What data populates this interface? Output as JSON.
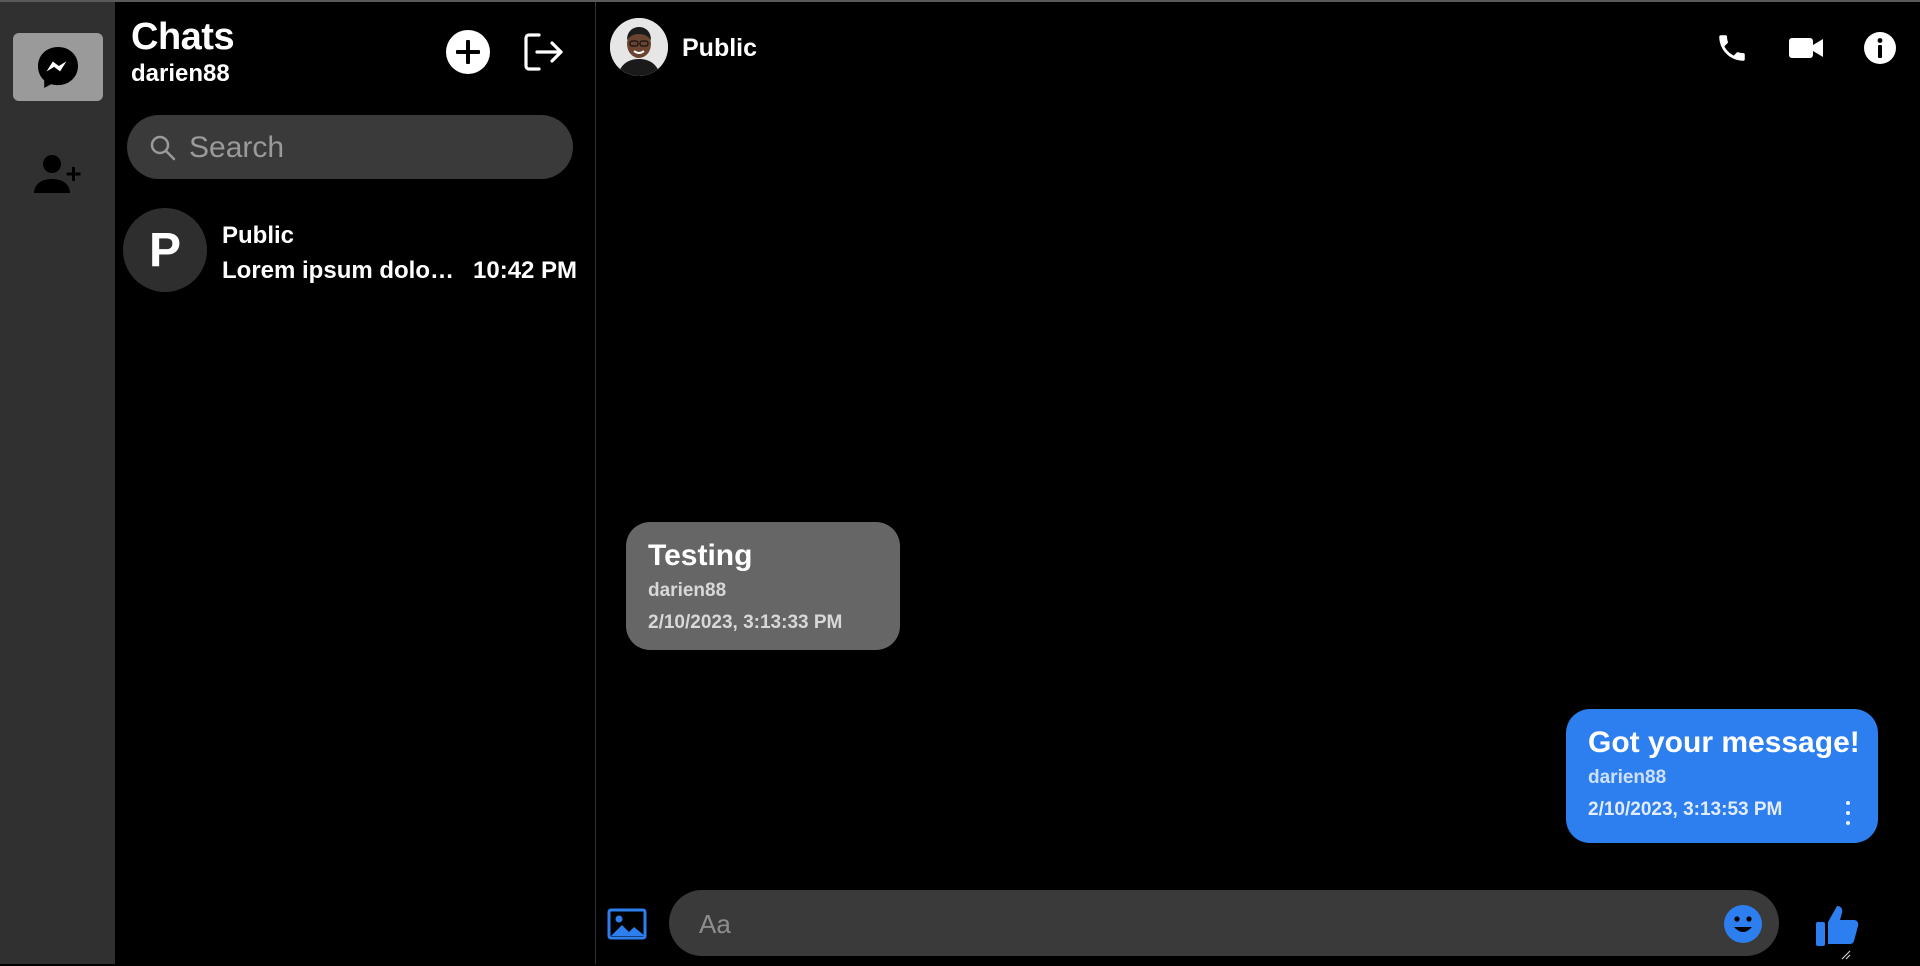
{
  "colors": {
    "accent": "#2d7ff0",
    "rail": "#303030",
    "incoming_bubble": "#666666",
    "input_bg": "#3a3a3a"
  },
  "rail": {
    "items": [
      {
        "name": "chats",
        "icon": "messenger-icon",
        "active": true
      },
      {
        "name": "add-friend",
        "icon": "add-user-icon",
        "active": false
      }
    ]
  },
  "sidebar": {
    "title": "Chats",
    "username": "darien88",
    "new_chat_icon": "plus-circle-icon",
    "logout_icon": "logout-icon",
    "search_placeholder": "Search",
    "conversations": [
      {
        "initial": "P",
        "name": "Public",
        "preview": "Lorem ipsum dolor sit amet",
        "time": "10:42 PM"
      }
    ]
  },
  "chat": {
    "title": "Public",
    "actions": [
      "phone-icon",
      "video-icon",
      "info-icon"
    ],
    "messages": [
      {
        "direction": "incoming",
        "text": "Testing",
        "author": "darien88",
        "timestamp": "2/10/2023, 3:13:33 PM"
      },
      {
        "direction": "outgoing",
        "text": "Got your message!",
        "author": "darien88",
        "timestamp": "2/10/2023, 3:13:53 PM"
      }
    ],
    "composer": {
      "placeholder": "Aa"
    }
  }
}
